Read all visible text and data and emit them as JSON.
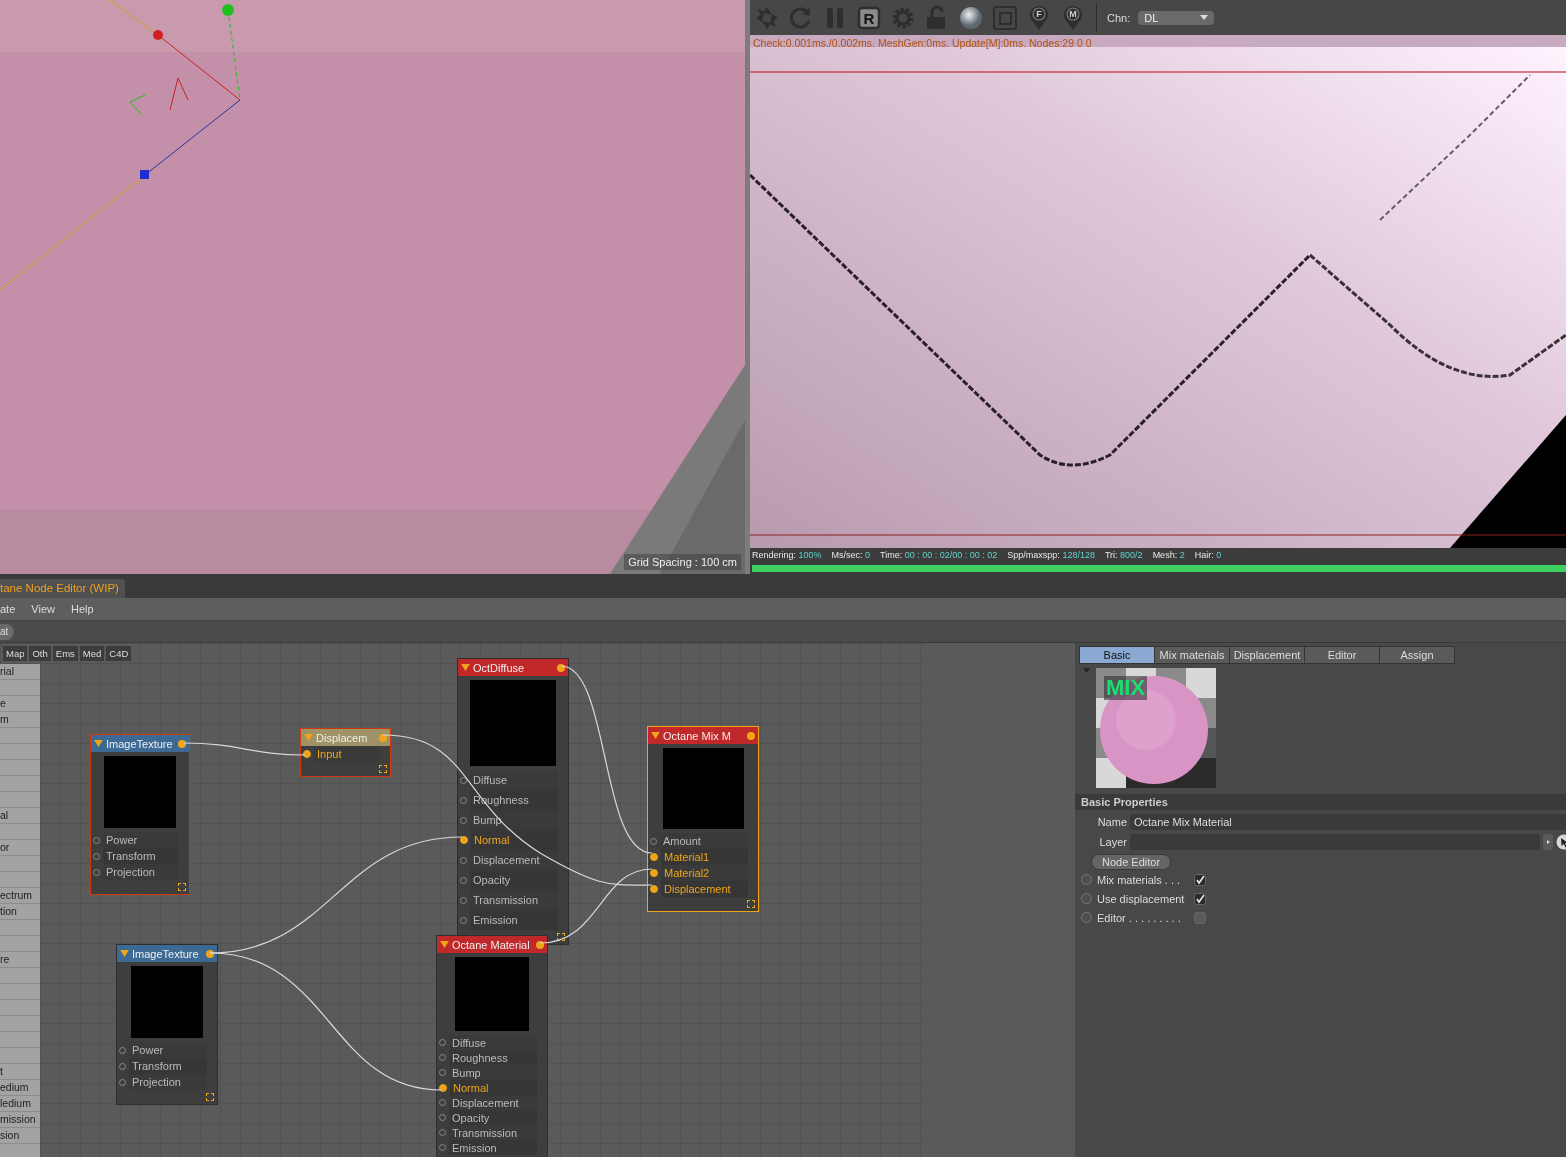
{
  "viewport": {
    "grid_spacing": "Grid Spacing : 100 cm"
  },
  "render": {
    "toolbar": [
      {
        "kind": "aperture"
      },
      {
        "kind": "refresh"
      },
      {
        "kind": "pause"
      },
      {
        "kind": "letter-box",
        "letter": "R"
      },
      {
        "kind": "gear"
      },
      {
        "kind": "lock"
      },
      {
        "kind": "sphere"
      },
      {
        "kind": "region"
      },
      {
        "kind": "pin",
        "letter": "F"
      },
      {
        "kind": "pin",
        "letter": "M"
      }
    ],
    "channel_label": "Chn:",
    "channel": "DL",
    "status": "Check:0.001ms./0.002ms. MeshGen:0ms. Update[M]:0ms. Nodes:29  0 0",
    "stats": [
      {
        "label": "Rendering:",
        "value": "100%"
      },
      {
        "label": "Ms/sec:",
        "value": "0"
      },
      {
        "label": "Time:",
        "value": "00 : 00 : 02/00 : 00 : 02"
      },
      {
        "label": "Spp/maxspp:",
        "value": "128/128"
      },
      {
        "label": "Tri:",
        "value": "800/2"
      },
      {
        "label": "Mesh:",
        "value": "2"
      },
      {
        "label": "Hair:",
        "value": "0"
      }
    ],
    "progress": {
      "level": 1
    }
  },
  "node_editor": {
    "title": "tane Node Editor (WIP)",
    "menu": [
      "ate",
      "View",
      "Help"
    ],
    "toolbar_button": "at",
    "categories": [
      "Map",
      "Oth",
      "Ems",
      "Med",
      "C4D"
    ],
    "sidebar_items": [
      "rial",
      "e",
      "m",
      "al",
      "or",
      "ectrum",
      "tion",
      "re",
      "t",
      "edium",
      "ledium",
      "mission",
      "sion"
    ],
    "nodes": [
      {
        "title": "ImageTexture",
        "kind": "texture",
        "selected": true,
        "active": false,
        "ports": [
          {
            "name": "Power",
            "connected": false
          },
          {
            "name": "Transform",
            "connected": false
          },
          {
            "name": "Projection",
            "connected": false
          }
        ]
      },
      {
        "title": "Displacem",
        "kind": "displacement",
        "selected": true,
        "active": false,
        "ports": [
          {
            "name": "Input",
            "connected": true
          }
        ]
      },
      {
        "title": "OctDiffuse",
        "kind": "material",
        "selected": false,
        "active": false,
        "ports": [
          {
            "name": "Diffuse",
            "connected": false
          },
          {
            "name": "Roughness",
            "connected": false
          },
          {
            "name": "Bump",
            "connected": false
          },
          {
            "name": "Normal",
            "connected": true
          },
          {
            "name": "Displacement",
            "connected": false
          },
          {
            "name": "Opacity",
            "connected": false
          },
          {
            "name": "Transmission",
            "connected": false
          },
          {
            "name": "Emission",
            "connected": false
          }
        ]
      },
      {
        "title": "Octane Mix M",
        "kind": "material",
        "selected": true,
        "active": true,
        "ports": [
          {
            "name": "Amount",
            "connected": false
          },
          {
            "name": "Material1",
            "connected": true
          },
          {
            "name": "Material2",
            "connected": true
          },
          {
            "name": "Displacement",
            "connected": true
          }
        ]
      },
      {
        "title": "ImageTexture",
        "kind": "texture",
        "selected": false,
        "active": false,
        "ports": [
          {
            "name": "Power",
            "connected": false
          },
          {
            "name": "Transform",
            "connected": false
          },
          {
            "name": "Projection",
            "connected": false
          }
        ]
      },
      {
        "title": "Octane Material",
        "kind": "material",
        "selected": false,
        "active": false,
        "ports": [
          {
            "name": "Diffuse",
            "connected": false
          },
          {
            "name": "Roughness",
            "connected": false
          },
          {
            "name": "Bump",
            "connected": false
          },
          {
            "name": "Normal",
            "connected": true
          },
          {
            "name": "Displacement",
            "connected": false
          },
          {
            "name": "Opacity",
            "connected": false
          },
          {
            "name": "Transmission",
            "connected": false
          },
          {
            "name": "Emission",
            "connected": false
          }
        ]
      }
    ]
  },
  "properties": {
    "tabs": [
      {
        "label": "Basic",
        "selected": true
      },
      {
        "label": "Mix materials",
        "selected": false
      },
      {
        "label": "Displacement",
        "selected": false
      },
      {
        "label": "Editor",
        "selected": false
      },
      {
        "label": "Assign",
        "selected": false
      }
    ],
    "preview_label": "MIX",
    "section": "Basic Properties",
    "name_label": "Name",
    "name_value": "Octane Mix Material",
    "layer_label": "Layer",
    "node_editor_button": "Node Editor",
    "options": [
      {
        "label": "Mix materials . . .",
        "checked": true,
        "keyed": false
      },
      {
        "label": "Use displacement",
        "checked": true,
        "keyed": false
      },
      {
        "label": "Editor . . . . . . . . .",
        "checked": false,
        "keyed": false
      }
    ]
  }
}
